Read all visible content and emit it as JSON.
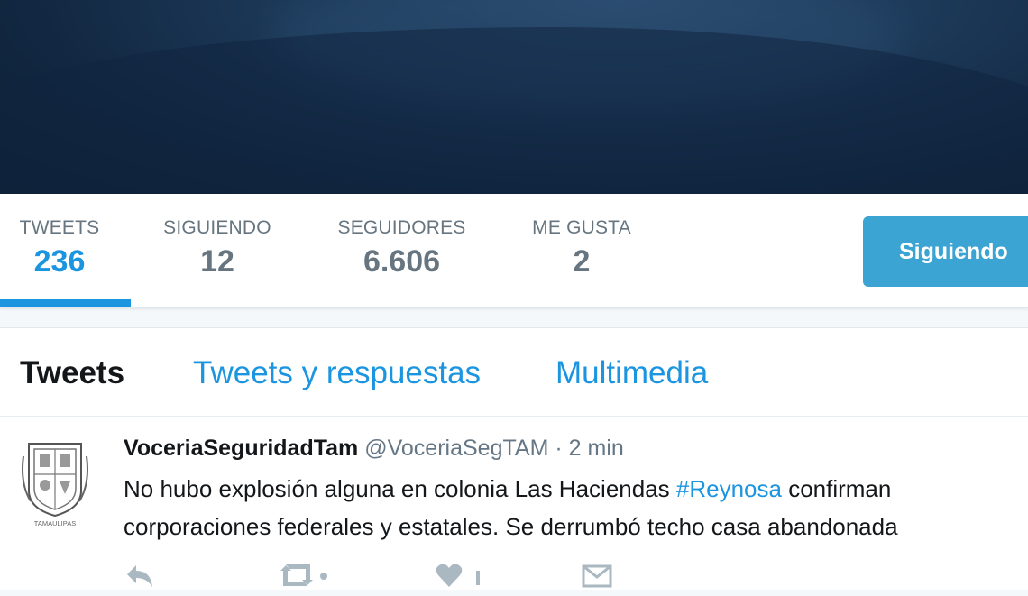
{
  "stats": {
    "tweets": {
      "label": "TWEETS",
      "value": "236"
    },
    "following": {
      "label": "SIGUIENDO",
      "value": "12"
    },
    "followers": {
      "label": "SEGUIDORES",
      "value": "6.606"
    },
    "likes": {
      "label": "ME GUSTA",
      "value": "2"
    }
  },
  "follow_button": {
    "label": "Siguiendo"
  },
  "tabs": [
    {
      "label": "Tweets",
      "active": true
    },
    {
      "label": "Tweets y respuestas",
      "active": false
    },
    {
      "label": "Multimedia",
      "active": false
    }
  ],
  "tweet": {
    "name": "VoceriaSeguridadTam",
    "handle": "@VoceriaSegTAM",
    "separator": "·",
    "time": "2 min",
    "text_before": "No hubo explosión alguna en colonia Las Haciendas ",
    "hashtag": "#Reynosa",
    "text_after": " confirman corporaciones federales y estatales. Se derrumbó techo casa abandonada",
    "avatar_caption": "TAMAULIPAS"
  },
  "tweet_actions": [
    "reply-icon",
    "retweet-icon",
    "like-icon",
    "message-icon"
  ],
  "colors": {
    "accent": "#1b95e0",
    "follow_button": "#3ca4d2",
    "muted": "#66757f"
  }
}
